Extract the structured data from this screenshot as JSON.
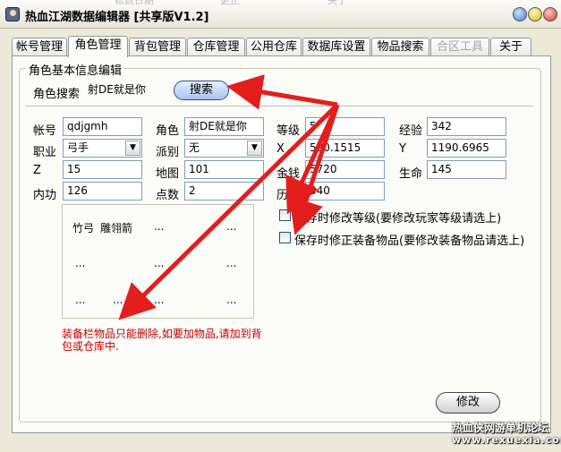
{
  "window": {
    "title": "热血江湖数据编辑器 [共享版V1.2]",
    "ghost_text_left": "帐数日期",
    "ghost_text_mid": "更正",
    "ghost_text_right": "关于"
  },
  "tabs": [
    "帐号管理",
    "角色管理",
    "背包管理",
    "仓库管理",
    "公用仓库",
    "数据库设置",
    "物品搜索",
    "合区工具",
    "关于"
  ],
  "active_tab": "角色管理",
  "group": {
    "title": "角色基本信息编辑"
  },
  "search": {
    "label": "角色搜索",
    "value": "射DE就是你",
    "button": "搜索"
  },
  "fields": {
    "account": {
      "label": "帐号",
      "value": "qdjgmh"
    },
    "role": {
      "label": "角色",
      "value": "射DE就是你"
    },
    "level": {
      "label": "等级",
      "value": "5"
    },
    "exp": {
      "label": "经验",
      "value": "342"
    },
    "job": {
      "label": "职业",
      "value": "弓手"
    },
    "faction": {
      "label": "派别",
      "value": "无"
    },
    "x": {
      "label": "X",
      "value": "590.1515"
    },
    "y": {
      "label": "Y",
      "value": "1190.6965"
    },
    "z": {
      "label": "Z",
      "value": "15"
    },
    "map": {
      "label": "地图",
      "value": "101"
    },
    "gold": {
      "label": "金钱",
      "value": "5720"
    },
    "hp": {
      "label": "生命",
      "value": "145"
    },
    "neigong": {
      "label": "内功",
      "value": "126"
    },
    "points": {
      "label": "点数",
      "value": "2"
    },
    "history": {
      "label": "历练",
      "value": "340"
    }
  },
  "checkboxes": [
    {
      "label": "保存时修改等级(要修改玩家等级请选上)",
      "checked": false
    },
    {
      "label": "保存时修正装备物品(要修改装备物品请选上)",
      "checked": false
    }
  ],
  "equipment": {
    "item_1": "竹弓",
    "item_2": "雕翎箭",
    "placeholder": "..."
  },
  "note": "装备栏物品只能删除,如要加物品,请加到背包或仓库中.",
  "modify_button": "修改",
  "watermark": {
    "line1": "热血侠网游单机论坛",
    "line2": "www.rexuexia.com"
  },
  "colors": {
    "arrow": "#e41d1d",
    "note": "#c00000"
  }
}
